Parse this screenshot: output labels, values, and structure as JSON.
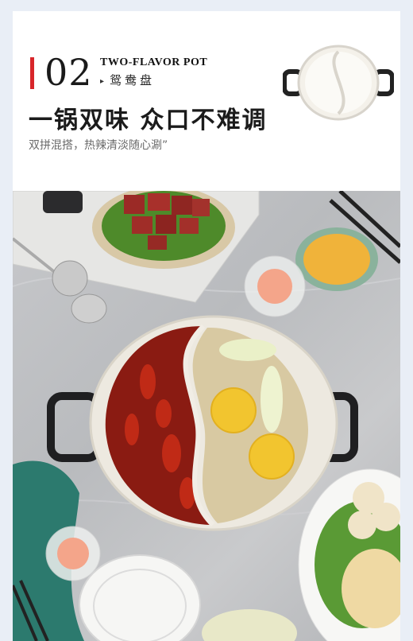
{
  "header": {
    "number": "02",
    "title_en": "TWO-FLAVOR POT",
    "title_cn": "鸳鸯盘",
    "headline": "一锅双味 众口不难调",
    "tagline": "双拼混搭，热辣清淡随心涮”"
  },
  "icons": {
    "pot": "two-flavor-pot-icon"
  },
  "colors": {
    "accent": "#d8262a",
    "background": "#e9eef6"
  }
}
